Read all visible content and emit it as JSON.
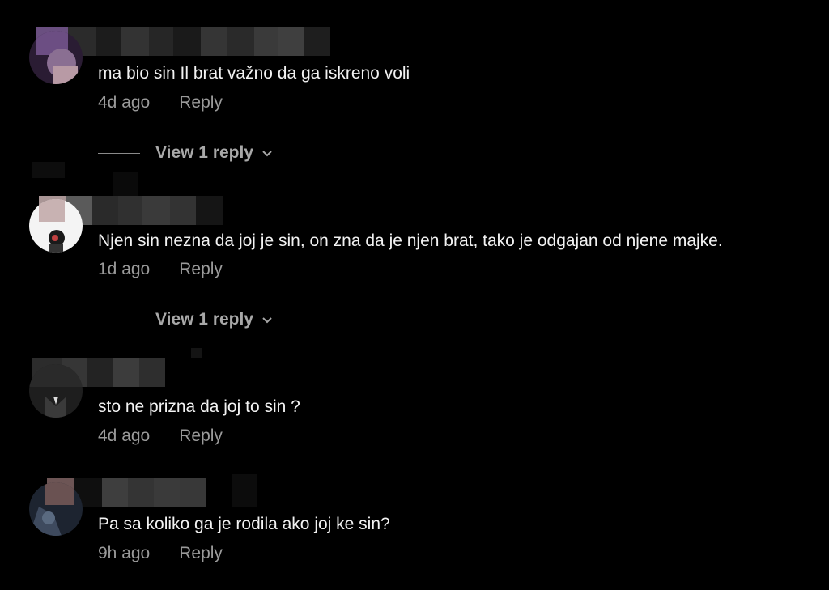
{
  "comments": [
    {
      "text": "ma bio sin Il brat važno da ga iskreno voli",
      "time": "4d ago",
      "reply_label": "Reply",
      "view_replies": "View 1 reply"
    },
    {
      "text": "Njen sin nezna da joj je sin, on zna da je njen brat, tako je odgajan od njene majke.",
      "time": "1d ago",
      "reply_label": "Reply",
      "view_replies": "View 1 reply"
    },
    {
      "text": "sto ne prizna da joj to sin ?",
      "time": "4d ago",
      "reply_label": "Reply"
    },
    {
      "text": "Pa sa koliko ga je rodila ako joj ke sin?",
      "time": "9h ago",
      "reply_label": "Reply"
    }
  ],
  "icons": {
    "chevron": "chevron-down-icon",
    "avatar": "avatar"
  }
}
